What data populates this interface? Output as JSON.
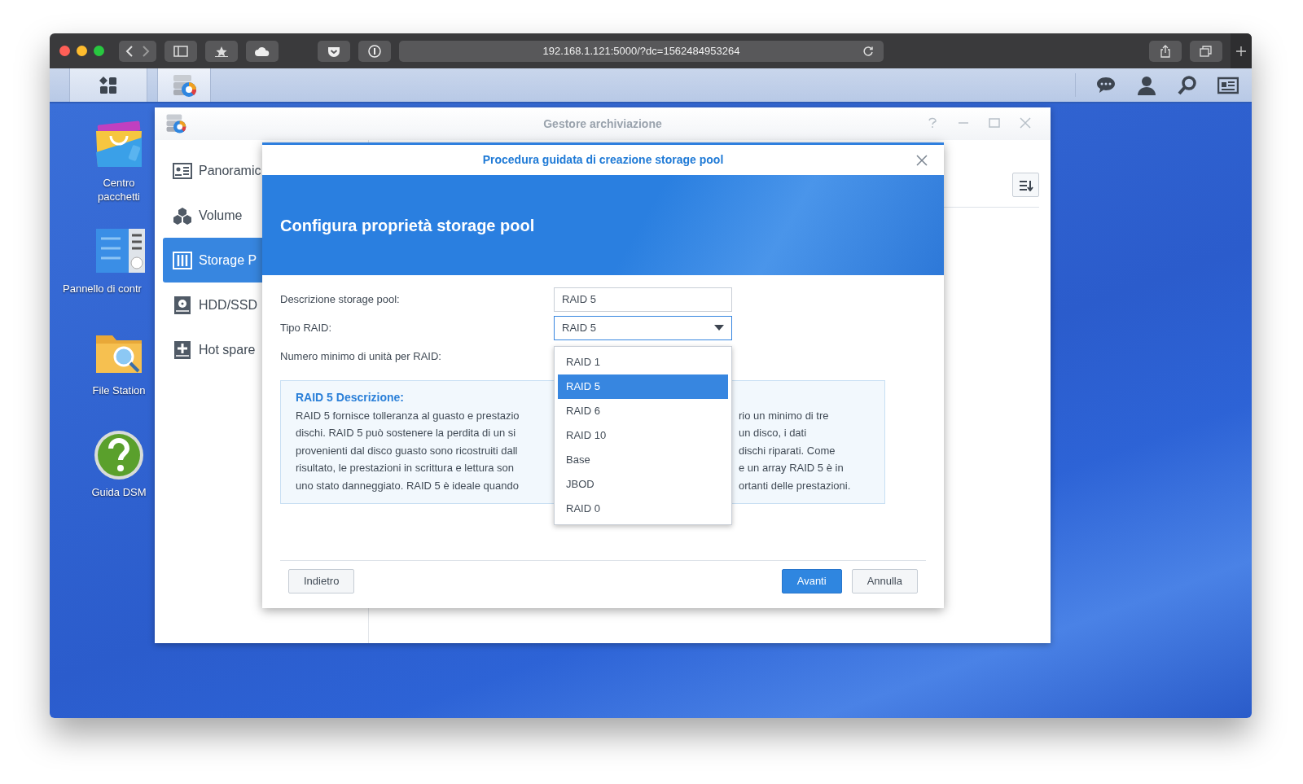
{
  "browser": {
    "url": "192.168.1.121:5000/?dc=1562484953264"
  },
  "desktop_icons": [
    {
      "label": "Centro pacchetti"
    },
    {
      "label": "Pannello di contr"
    },
    {
      "label": "File Station"
    },
    {
      "label": "Guida DSM"
    }
  ],
  "storage_manager": {
    "title": "Gestore archiviazione",
    "sidebar": {
      "items": [
        {
          "label": "Panoramic",
          "selected": false
        },
        {
          "label": "Volume",
          "selected": false
        },
        {
          "label": "Storage P",
          "selected": true
        },
        {
          "label": "HDD/SSD",
          "selected": false
        },
        {
          "label": "Hot spare",
          "selected": false
        }
      ]
    }
  },
  "dialog": {
    "title": "Procedura guidata di creazione storage pool",
    "heading": "Configura proprietà storage pool",
    "fields": [
      {
        "label": "Descrizione storage pool:",
        "kind": "text",
        "value": "RAID 5"
      },
      {
        "label": "Tipo RAID:",
        "kind": "select",
        "value": "RAID 5"
      },
      {
        "label": "Numero minimo di unità per RAID:",
        "kind": "hidden"
      }
    ],
    "description": {
      "title": "RAID 5 Descrizione:",
      "lines": [
        {
          "left": "RAID 5 fornisce tolleranza al guasto e prestazio",
          "right": "rio un minimo di tre"
        },
        {
          "left": "dischi. RAID 5 può sostenere la perdita di un si",
          "right": "un disco, i dati"
        },
        {
          "left": "provenienti dal disco guasto sono ricostruiti dall",
          "right": "dischi riparati. Come"
        },
        {
          "left": "risultato, le prestazioni in scrittura e lettura son",
          "right": "e un array RAID 5 è in"
        },
        {
          "left": "uno stato danneggiato. RAID 5 è ideale quando",
          "right": "ortanti delle prestazioni."
        }
      ]
    },
    "dropdown": {
      "options": [
        {
          "label": "RAID 1",
          "selected": false
        },
        {
          "label": "RAID 5",
          "selected": true
        },
        {
          "label": "RAID 6",
          "selected": false
        },
        {
          "label": "RAID 10",
          "selected": false
        },
        {
          "label": "Base",
          "selected": false
        },
        {
          "label": "JBOD",
          "selected": false
        },
        {
          "label": "RAID 0",
          "selected": false
        }
      ]
    },
    "buttons": [
      {
        "label": "Indietro",
        "kind": "secondary"
      },
      {
        "label": "Avanti",
        "kind": "primary"
      },
      {
        "label": "Annulla",
        "kind": "secondary"
      }
    ]
  }
}
